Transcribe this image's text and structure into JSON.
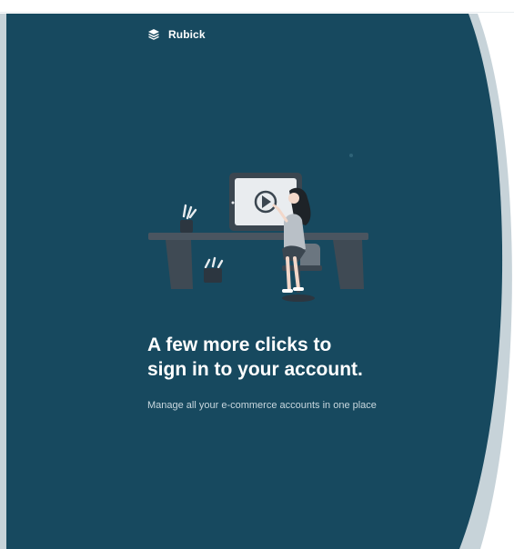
{
  "brand": {
    "name": "Rubick",
    "icon": "layers-icon"
  },
  "hero": {
    "headline_line1": "A few more clicks to",
    "headline_line2": "sign in to your account.",
    "subline": "Manage all your e-commerce accounts in one place"
  },
  "colors": {
    "panel": "#17495f",
    "panel_edge": "#c7d3d9",
    "text": "#ffffff",
    "muted_text": "#c8d7de"
  },
  "illustration": {
    "name": "person-at-desk-watching-video",
    "play_icon": "play-icon"
  }
}
